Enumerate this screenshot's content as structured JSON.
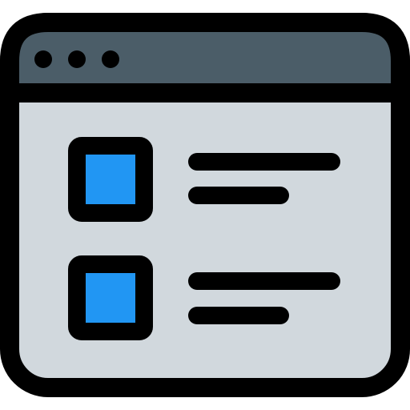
{
  "window": {
    "icon": "browser-window-list-icon",
    "titlebar_color": "#4b5d68",
    "body_color": "#d1d8dd",
    "outline_color": "#000000",
    "controls": [
      {
        "icon": "window-dot-icon"
      },
      {
        "icon": "window-dot-icon"
      },
      {
        "icon": "window-dot-icon"
      }
    ],
    "items": [
      {
        "thumbnail_icon": "square-thumbnail-icon",
        "thumbnail_color": "#2196f3",
        "text_lines": 2
      },
      {
        "thumbnail_icon": "square-thumbnail-icon",
        "thumbnail_color": "#2196f3",
        "text_lines": 2
      }
    ]
  }
}
